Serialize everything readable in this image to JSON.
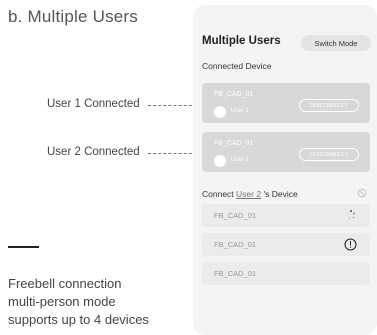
{
  "section_title": "b. Multiple Users",
  "annotations": {
    "user1": "User 1 Connected",
    "user2": "User 2 Connected"
  },
  "description": {
    "line1": "Freebell connection",
    "line2": "multi-person mode",
    "line3": "supports up to 4 devices"
  },
  "panel": {
    "title": "Multiple Users",
    "switch_label": "Switch Mode",
    "connected_heading": "Connected Device",
    "connected": [
      {
        "device": "FB_CAD_01",
        "user": "User 1",
        "action": "DISCONNECT"
      },
      {
        "device": "FB_CAD_01",
        "user": "User 2",
        "action": "DISCONNECT"
      }
    ],
    "connect_prefix": "Connect",
    "connect_user": "User 2",
    "connect_suffix": "'s Device",
    "devices": [
      {
        "device": "FB_CAD_01",
        "icon": "loading-spinner-icon"
      },
      {
        "device": "FB_CAD_01",
        "icon": "exclamation-circle-icon"
      },
      {
        "device": "FB_CAD_01",
        "icon": ""
      }
    ]
  },
  "colors": {
    "panel_bg": "#f4f4f4",
    "connected_card": "#d8d8d8",
    "device_card": "#ebebeb"
  }
}
